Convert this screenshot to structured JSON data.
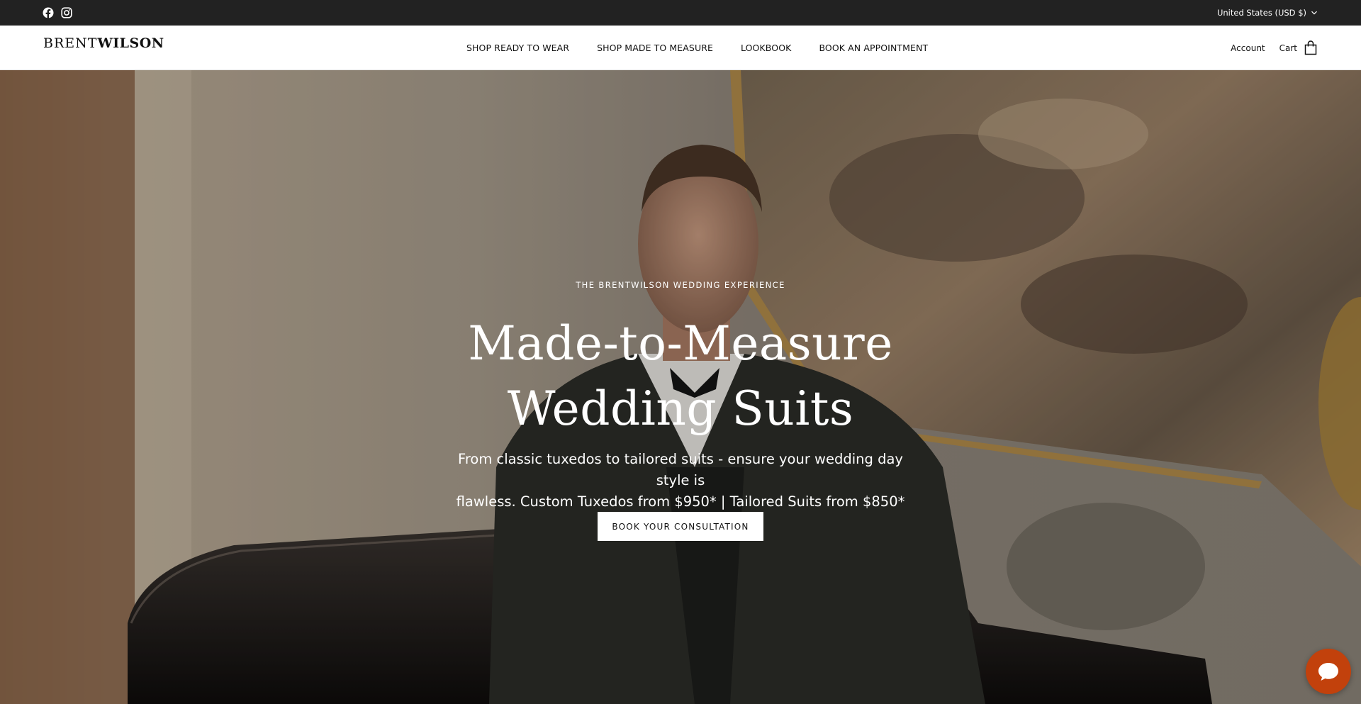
{
  "topbar": {
    "social": [
      {
        "icon": "facebook-icon"
      },
      {
        "icon": "instagram-icon"
      }
    ],
    "locale": "United States (USD $)"
  },
  "header": {
    "logo_light": "BRENT",
    "logo_bold": "WILSON",
    "nav": [
      {
        "label": "SHOP READY TO WEAR"
      },
      {
        "label": "SHOP MADE TO MEASURE"
      },
      {
        "label": "LOOKBOOK"
      },
      {
        "label": "BOOK AN APPOINTMENT"
      }
    ],
    "account_label": "Account",
    "cart_label": "Cart"
  },
  "hero": {
    "eyebrow": "THE BRENTWILSON WEDDING EXPERIENCE",
    "headline_line1": "Made-to-Measure",
    "headline_line2": "Wedding Suits",
    "subtext_line1": "From classic tuxedos to tailored suits - ensure your wedding day style is",
    "subtext_line2": "flawless. Custom Tuxedos from $950* | Tailored Suits from $850*",
    "cta_label": "BOOK YOUR CONSULTATION"
  },
  "chat": {
    "icon": "chat-bubble-icon",
    "color": "#c2410c"
  },
  "colors": {
    "topbar_bg": "#222222",
    "header_bg": "#ffffff",
    "text": "#111111"
  }
}
